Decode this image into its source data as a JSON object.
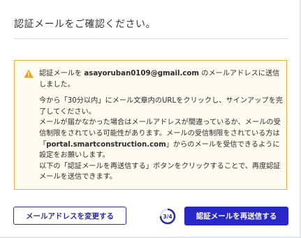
{
  "dialog": {
    "title": "認証メールをご確認ください。"
  },
  "notice": {
    "icon": "warning-icon",
    "color_border": "#f0b23a",
    "color_background": "#fffbf0",
    "line1_prefix": "認証メールを",
    "email": "asayoruban0109@gmail.com",
    "line1_suffix": "のメールアドレスに送信しました。",
    "p2": "今から「30分以内」にメール文章内のURLをクリックし、サインアップを完了してください。",
    "p3_before": "メールが届かなかった場合はメールアドレスが間違っているか、メールの受信制限をされている可能性があります。メールの受信制限をされている方は「",
    "domain": "portal.smartconstruction.com",
    "p3_after": "」からのメールを受信できるように設定をお願いします。",
    "p4": "以下の「認証メールを再送信する」ボタンをクリックすることで、再度認証メールを送信できます。"
  },
  "actions": {
    "change_email_label": "メールアドレスを変更する",
    "step_label": "3/4",
    "step_progress": 0.75,
    "resend_label": "認証メールを再送信する",
    "accent_color": "#2a27c8"
  }
}
